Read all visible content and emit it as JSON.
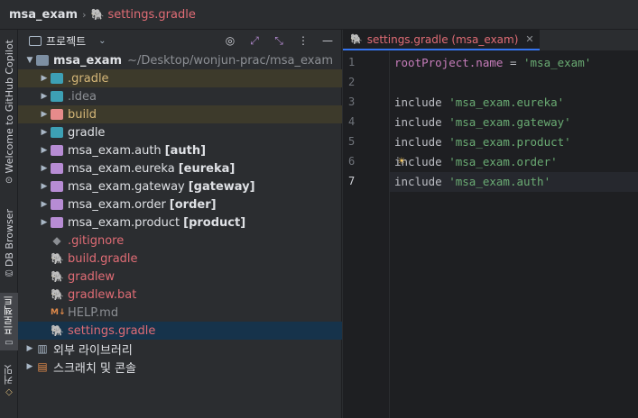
{
  "breadcrumb": {
    "root": "msa_exam",
    "separator": "›",
    "file": "settings.gradle"
  },
  "toolstrip": {
    "tabs": [
      {
        "label": "Welcome to GitHub Copilot",
        "icon": "copilot-icon"
      },
      {
        "label": "DB Browser",
        "icon": "db-icon"
      },
      {
        "label": "프로젝트",
        "icon": "project-icon"
      },
      {
        "label": "커밋",
        "icon": "commit-icon"
      }
    ]
  },
  "project": {
    "title": "프로젝트",
    "root": {
      "name": "msa_exam",
      "path": "~/Desktop/wonjun-prac/msa_exam"
    },
    "items": [
      {
        "name": ".gradle",
        "tag": ""
      },
      {
        "name": ".idea",
        "tag": ""
      },
      {
        "name": "build",
        "tag": ""
      },
      {
        "name": "gradle",
        "tag": ""
      },
      {
        "name": "msa_exam.auth",
        "tag": "[auth]"
      },
      {
        "name": "msa_exam.eureka",
        "tag": "[eureka]"
      },
      {
        "name": "msa_exam.gateway",
        "tag": "[gateway]"
      },
      {
        "name": "msa_exam.order",
        "tag": "[order]"
      },
      {
        "name": "msa_exam.product",
        "tag": "[product]"
      },
      {
        "name": ".gitignore",
        "tag": ""
      },
      {
        "name": "build.gradle",
        "tag": ""
      },
      {
        "name": "gradlew",
        "tag": ""
      },
      {
        "name": "gradlew.bat",
        "tag": ""
      },
      {
        "name": "HELP.md",
        "tag": ""
      },
      {
        "name": "settings.gradle",
        "tag": ""
      }
    ],
    "external": "외부 라이브러리",
    "scratches": "스크래치 및 콘솔"
  },
  "editor": {
    "tab_label": "settings.gradle (msa_exam)",
    "lines": [
      {
        "num": "1",
        "a": "rootProject.name",
        "b": " = ",
        "c": "'msa_exam'"
      },
      {
        "num": "2",
        "a": "",
        "b": "",
        "c": ""
      },
      {
        "num": "3",
        "a": "include",
        "b": " ",
        "c": "'msa_exam.eureka'"
      },
      {
        "num": "4",
        "a": "include",
        "b": " ",
        "c": "'msa_exam.gateway'"
      },
      {
        "num": "5",
        "a": "include",
        "b": " ",
        "c": "'msa_exam.product'"
      },
      {
        "num": "6",
        "a": "include",
        "b": " ",
        "c": "'msa_exam.order'"
      },
      {
        "num": "7",
        "a": "include",
        "b": " ",
        "c": "'msa_exam.auth'"
      }
    ],
    "current_line": "7"
  },
  "colors": {
    "accent": "#3574f0",
    "string": "#6aab73",
    "keyword": "#c77dbb",
    "error_file": "#e06c75"
  }
}
